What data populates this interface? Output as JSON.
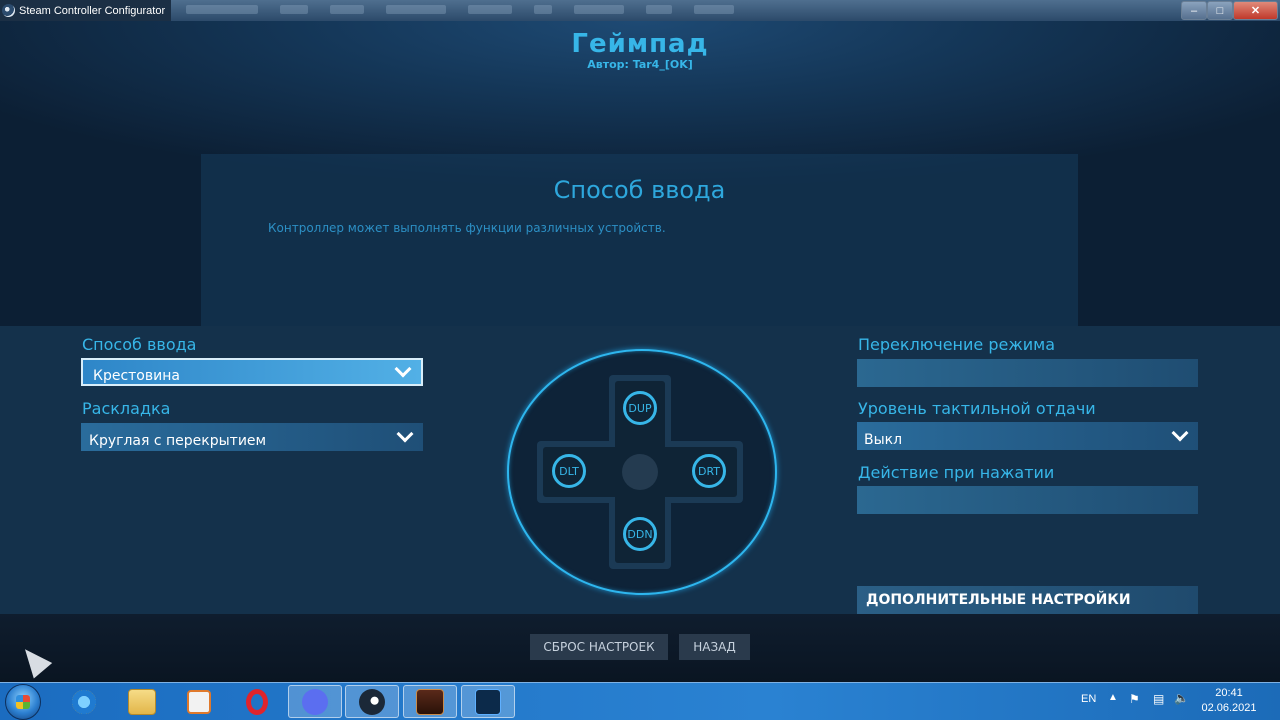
{
  "window": {
    "title": "Steam Controller Configurator"
  },
  "header": {
    "title": "Геймпад",
    "author": "Автор: Tar4_[OK]"
  },
  "info_panel": {
    "title": "Способ ввода",
    "description": "Контроллер может выполнять функции различных устройств."
  },
  "left": {
    "input_label": "Способ ввода",
    "input_value": "Крестовина",
    "layout_label": "Раскладка",
    "layout_value": "Круглая с перекрытием"
  },
  "right": {
    "mode_shift_label": "Переключение режима",
    "haptic_label": "Уровень тактильной отдачи",
    "haptic_value": "Выкл",
    "click_action_label": "Действие при нажатии",
    "advanced_button": "ДОПОЛНИТЕЛЬНЫЕ НАСТРОЙКИ"
  },
  "dpad": {
    "up": "DUP",
    "down": "DDN",
    "left": "DLT",
    "right": "DRT"
  },
  "bottom": {
    "reset_button": "СБРОС НАСТРОЕК",
    "back_button": "НАЗАД"
  },
  "taskbar": {
    "icons": [
      "start-orb",
      "ie-icon",
      "explorer-icon",
      "media-player-icon",
      "opera-icon",
      "discord-icon",
      "steam-icon",
      "game-icon",
      "photoshop-icon"
    ],
    "language": "EN",
    "time": "20:41",
    "date": "02.06.2021"
  },
  "colors": {
    "accent": "#37b6e8",
    "panel": "#14314b",
    "taskbar": "#2a82d2"
  }
}
